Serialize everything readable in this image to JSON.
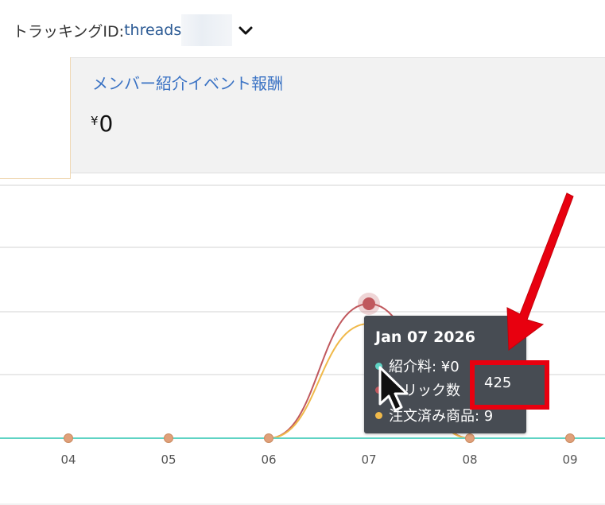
{
  "header": {
    "tracking_label": "トラッキングID:",
    "tracking_value": "threads",
    "dropdown_icon": "chevron-down-icon"
  },
  "panel": {
    "title": "メンバー紹介イベント報酬",
    "currency": "¥",
    "amount": "0"
  },
  "chart_data": {
    "type": "line",
    "x": [
      "04",
      "05",
      "06",
      "07",
      "08",
      "09"
    ],
    "series": [
      {
        "name": "紹介料",
        "color": "#5fd3c4",
        "values": [
          0,
          0,
          0,
          0,
          0,
          0
        ]
      },
      {
        "name": "クリック数",
        "color": "#c0585d",
        "values": [
          0,
          0,
          0,
          425,
          0,
          0
        ]
      },
      {
        "name": "注文済み商品",
        "color": "#f0b94a",
        "values": [
          0,
          0,
          0,
          9,
          0,
          0
        ]
      }
    ],
    "grid": true
  },
  "tooltip": {
    "date": "Jan 07 2026",
    "rows": [
      {
        "label": "紹介料: ¥0",
        "color": "#5fd3c4"
      },
      {
        "label": "クリック数",
        "color": "#c0585d"
      },
      {
        "label": "注文済み商品: 9",
        "color": "#f0b94a"
      }
    ],
    "highlight_value": "425"
  },
  "annotation": {
    "color": "#e8000f"
  }
}
